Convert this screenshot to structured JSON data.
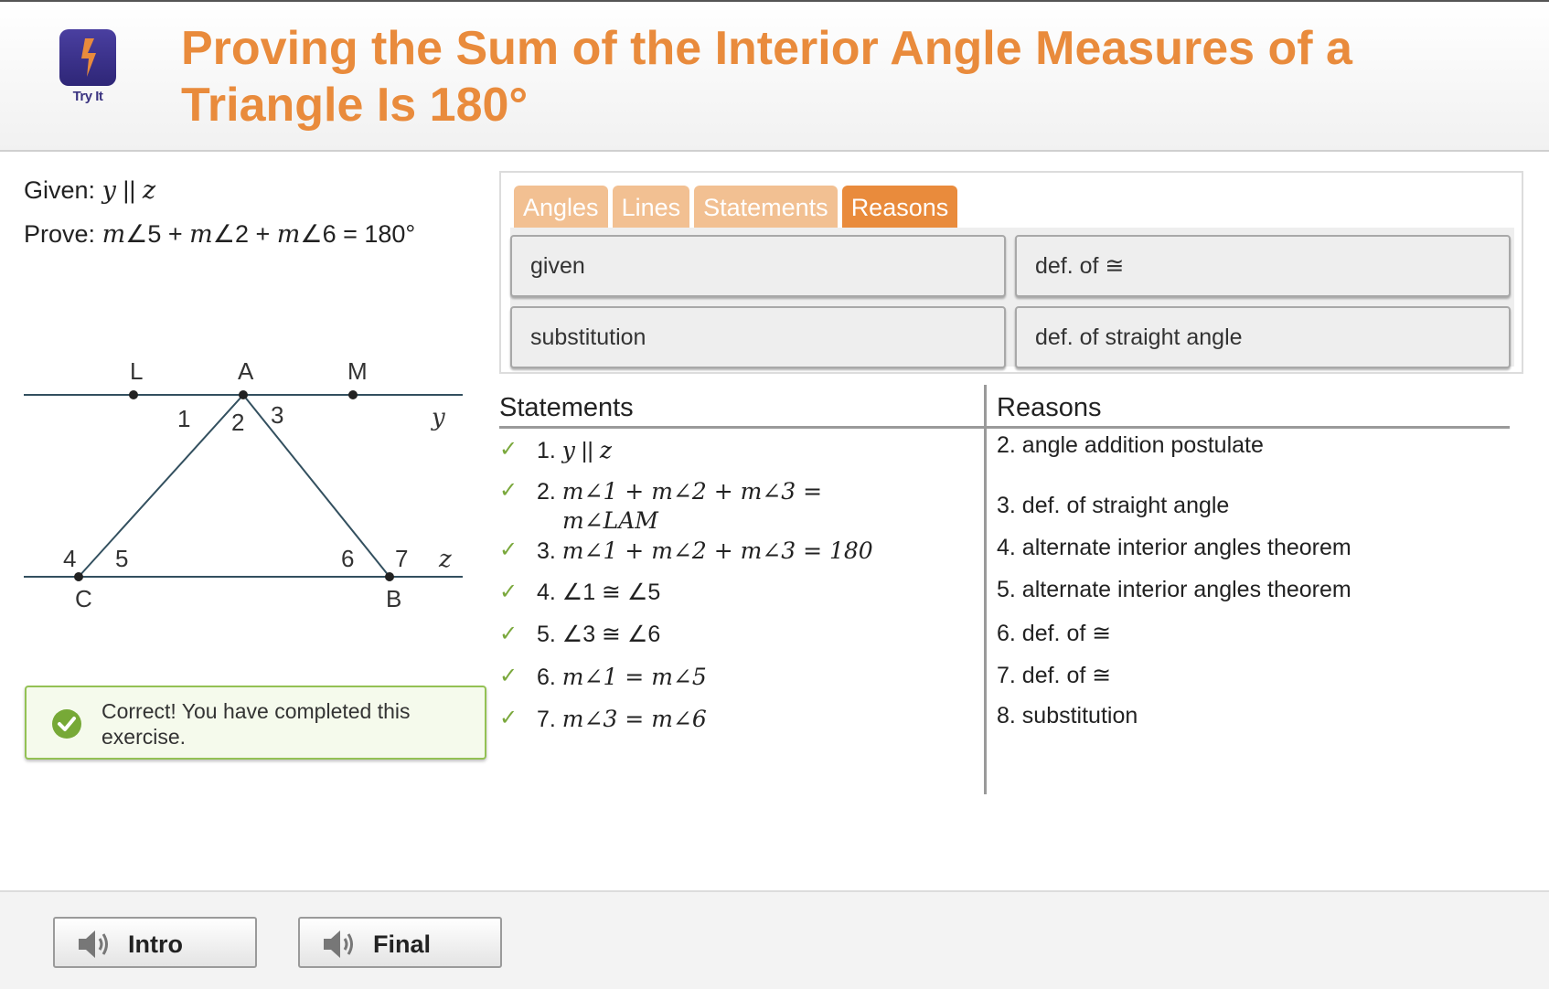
{
  "header": {
    "logo_caption": "Try It",
    "title": "Proving the Sum of the Interior Angle Measures of a Triangle Is 180°"
  },
  "given": {
    "label": "Given:",
    "var_y": "y",
    "parallel": " || ",
    "var_z": "z"
  },
  "prove": {
    "label": "Prove:",
    "m1": "m",
    "a1": "∠5 + ",
    "m2": "m",
    "a2": "∠2 + ",
    "m3": "m",
    "a3": "∠6 = 180°"
  },
  "diagram": {
    "points": {
      "L": "L",
      "A": "A",
      "M": "M",
      "C": "C",
      "B": "B"
    },
    "angles": {
      "a1": "1",
      "a2": "2",
      "a3": "3",
      "a4": "4",
      "a5": "5",
      "a6": "6",
      "a7": "7"
    },
    "lines": {
      "y": "y",
      "z": "z"
    },
    "line_color": "#33505f"
  },
  "feedback": {
    "text": "Correct! You have completed this exercise.",
    "color": "#77a937"
  },
  "bank": {
    "tabs": [
      {
        "label": "Angles",
        "active": false
      },
      {
        "label": "Lines",
        "active": false
      },
      {
        "label": "Statements",
        "active": false
      },
      {
        "label": "Reasons",
        "active": true
      }
    ],
    "tiles": [
      "given",
      "def. of ≅",
      "substitution",
      "def. of straight angle"
    ]
  },
  "proof": {
    "statements_header": "Statements",
    "reasons_header": "Reasons",
    "check": "✓",
    "statements": [
      {
        "num": "1. ",
        "v1": "y",
        "mid": " || ",
        "v2": "z"
      },
      {
        "num": "2. ",
        "line1": "m∠1 + m∠2 + m∠3 =",
        "line2": "m∠LAM"
      },
      {
        "num": "3. ",
        "text": "m∠1 + m∠2 + m∠3 = 180"
      },
      {
        "num": "4. ",
        "text": "∠1 ≅ ∠5"
      },
      {
        "num": "5. ",
        "text": "∠3 ≅ ∠6"
      },
      {
        "num": "6. ",
        "text": "m∠1 = m∠5"
      },
      {
        "num": "7. ",
        "text": "m∠3 = m∠6"
      }
    ],
    "reasons": [
      "2. angle addition postulate",
      "3. def. of straight angle",
      "4. alternate interior angles theorem",
      "5. alternate interior angles theorem",
      "6. def. of ≅",
      "7. def. of ≅",
      "8. substitution"
    ]
  },
  "footer": {
    "intro_label": "Intro",
    "final_label": "Final"
  },
  "colors": {
    "accent": "#e98b3c",
    "tab_inactive": "#f2c092",
    "check": "#7aa83c"
  }
}
